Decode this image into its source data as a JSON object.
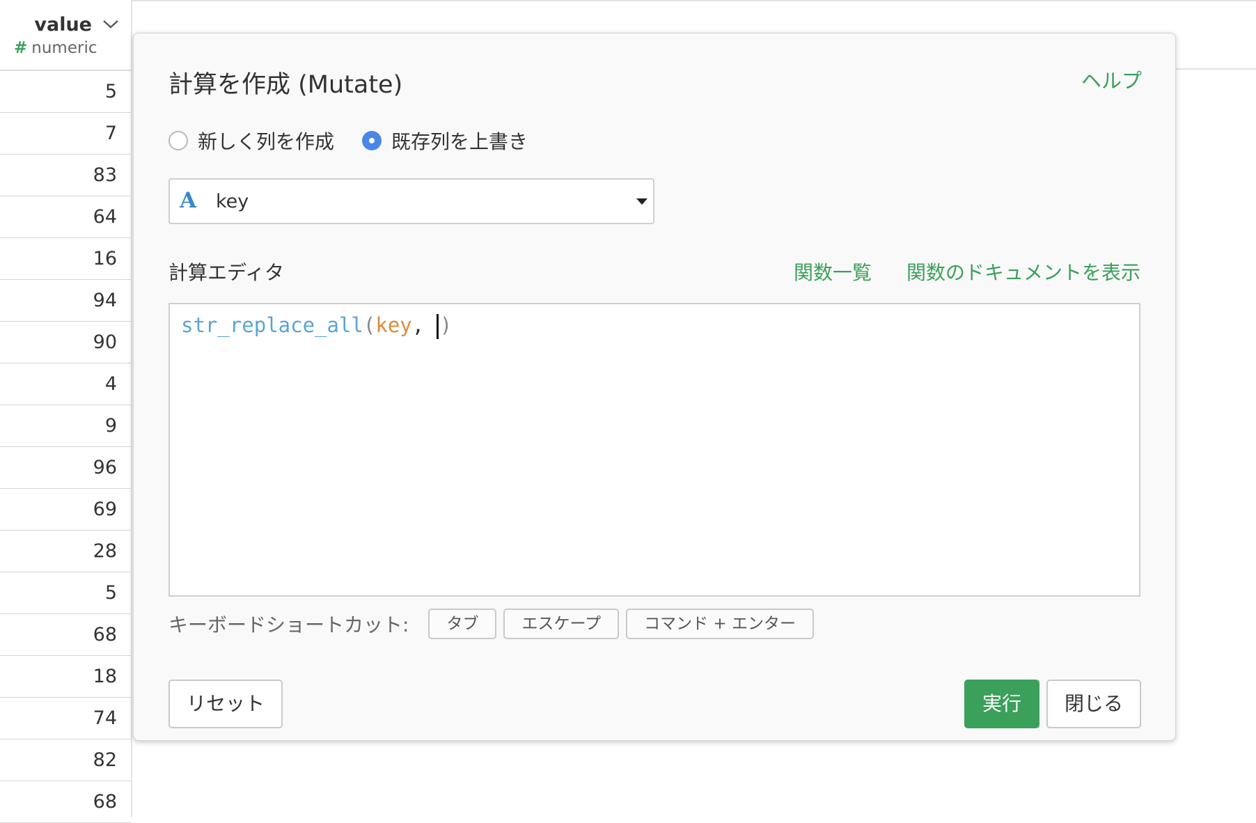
{
  "table": {
    "column": {
      "name": "value",
      "type_symbol": "#",
      "type_label": "numeric"
    },
    "values": [
      "5",
      "7",
      "83",
      "64",
      "16",
      "94",
      "90",
      "4",
      "9",
      "96",
      "69",
      "28",
      "5",
      "68",
      "18",
      "74",
      "82",
      "68"
    ]
  },
  "dialog": {
    "title": "計算を作成 (Mutate)",
    "help_label": "ヘルプ",
    "radio_options": [
      {
        "label": "新しく列を作成",
        "checked": false
      },
      {
        "label": "既存列を上書き",
        "checked": true
      }
    ],
    "column_select": {
      "type_icon": "A",
      "value": "key"
    },
    "editor_label": "計算エディタ",
    "function_list_link": "関数一覧",
    "function_docs_link": "関数のドキュメントを表示",
    "code": {
      "function": "str_replace_all",
      "open_paren": "(",
      "argument": "key",
      "separator": ", ",
      "close_paren": ")"
    },
    "shortcuts": {
      "label": "キーボードショートカット:",
      "keys": [
        "タブ",
        "エスケープ",
        "コマンド + エンター"
      ]
    },
    "buttons": {
      "reset": "リセット",
      "run": "実行",
      "close": "閉じる"
    }
  },
  "colors": {
    "accent_green": "#3aa05a",
    "radio_blue": "#4a86e8",
    "type_icon_blue": "#3b87c9",
    "code_function": "#5aa5d6",
    "code_argument": "#e08b3a"
  }
}
